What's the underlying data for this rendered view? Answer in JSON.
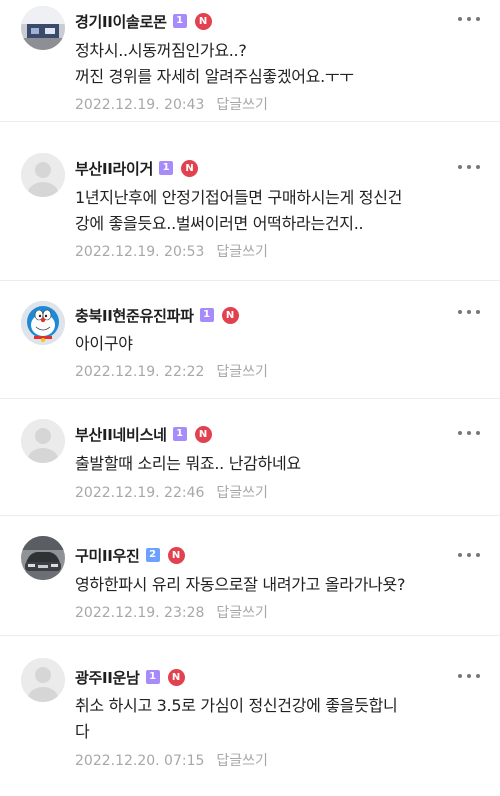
{
  "comments": [
    {
      "nickname": "경기II이솔로몬",
      "level": "1",
      "badge": "N",
      "text": "정차시..시동꺼짐인가요..?\n꺼진 경위를 자세히 알려주심좋겠어요.ㅜㅜ",
      "date": "2022.12.19. 20:43",
      "reply_label": "답글쓰기",
      "avatar": "photo-avatar"
    },
    {
      "nickname": "부산II라이거",
      "level": "1",
      "badge": "N",
      "text": "1년지난후에 안정기접어들면 구매하시는게 정신건\n강에 좋을듯요..벌써이러면 어떡하라는건지..",
      "date": "2022.12.19. 20:53",
      "reply_label": "답글쓰기",
      "avatar": "default-avatar"
    },
    {
      "nickname": "충북II현준유진파파",
      "level": "1",
      "badge": "N",
      "text": "아이구야",
      "date": "2022.12.19. 22:22",
      "reply_label": "답글쓰기",
      "avatar": "doraemon-avatar"
    },
    {
      "nickname": "부산II네비스네",
      "level": "1",
      "badge": "N",
      "text": "출발할때 소리는 뭐죠.. 난감하네요",
      "date": "2022.12.19. 22:46",
      "reply_label": "답글쓰기",
      "avatar": "default-avatar"
    },
    {
      "nickname": "구미II우진",
      "level": "2",
      "badge": "N",
      "text": "영하한파시 유리 자동으로잘 내려가고 올라가나욧?",
      "date": "2022.12.19. 23:28",
      "reply_label": "답글쓰기",
      "avatar": "car-avatar"
    },
    {
      "nickname": "광주II운남",
      "level": "1",
      "badge": "N",
      "text": "취소 하시고 3.5로 가심이 정신건강에 좋을듯합니\n다",
      "date": "2022.12.20. 07:15",
      "reply_label": "답글쓰기",
      "avatar": "default-avatar"
    }
  ],
  "icons": {
    "more": "more-vertical-dots-icon"
  },
  "colors": {
    "n_badge": "#e2424f",
    "level1": "#a78bfa",
    "level2": "#6ea0ff",
    "meta_text": "#a8a8a8"
  }
}
